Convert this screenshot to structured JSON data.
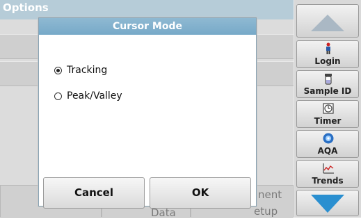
{
  "screen": {
    "title": "Options"
  },
  "background_buttons": {
    "label_a": "Data",
    "label_b": "nent",
    "label_c": "etup"
  },
  "dialog": {
    "title": "Cursor Mode",
    "options": [
      {
        "label": "Tracking",
        "selected": true
      },
      {
        "label": "Peak/Valley",
        "selected": false
      }
    ],
    "cancel_label": "Cancel",
    "ok_label": "OK"
  },
  "side_panel": {
    "items": [
      {
        "label": "Login",
        "icon": "login-person-icon"
      },
      {
        "label": "Sample ID",
        "icon": "sample-vial-icon"
      },
      {
        "label": "Timer",
        "icon": "timer-icon"
      },
      {
        "label": "AQA",
        "icon": "aqa-icon"
      },
      {
        "label": "Trends",
        "icon": "trends-chart-icon"
      }
    ],
    "scroll_up": "scroll-up-icon",
    "scroll_down": "scroll-down-icon"
  },
  "colors": {
    "dialog_title_bg": "#7fb0cd",
    "arrow_up": "#aab8c4",
    "arrow_down": "#2a8fd0"
  }
}
